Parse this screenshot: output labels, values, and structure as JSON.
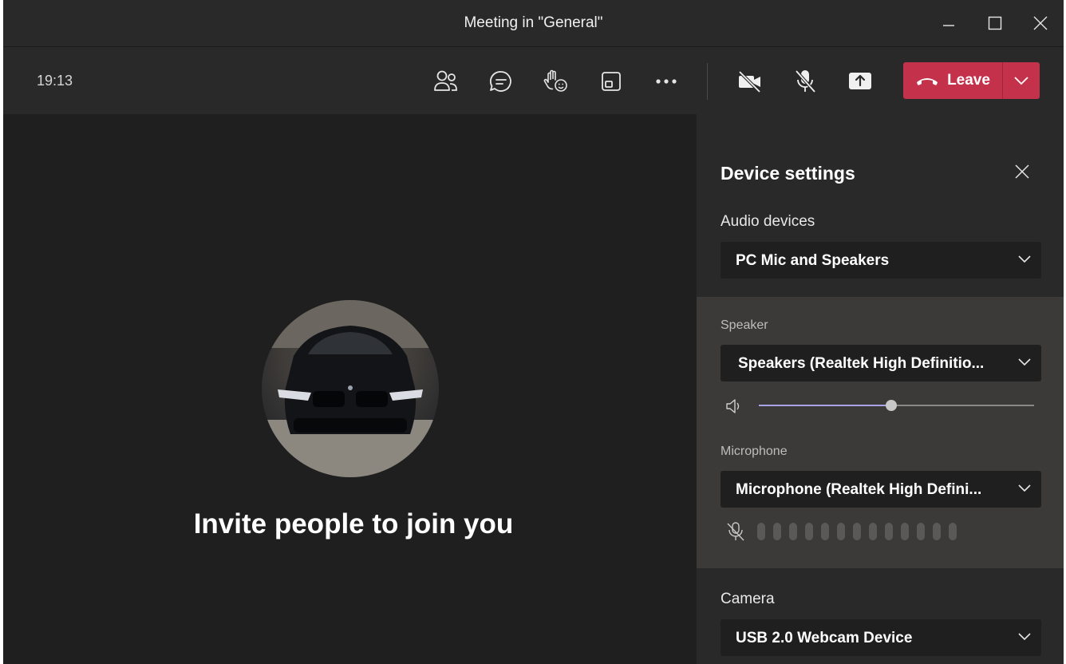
{
  "window": {
    "title": "Meeting in \"General\""
  },
  "toolbar": {
    "time": "19:13",
    "buttons": [
      {
        "name": "people",
        "icon": "people-icon"
      },
      {
        "name": "chat",
        "icon": "chat-icon"
      },
      {
        "name": "reactions",
        "icon": "raise-hand-icon"
      },
      {
        "name": "rooms",
        "icon": "room-icon"
      },
      {
        "name": "more",
        "icon": "more-icon"
      },
      {
        "name": "camera",
        "icon": "camera-off-icon"
      },
      {
        "name": "mic",
        "icon": "mic-off-icon"
      },
      {
        "name": "share",
        "icon": "share-icon"
      }
    ],
    "leave_label": "Leave",
    "leave_color": "#c4314b"
  },
  "stage": {
    "invite_text": "Invite people to join you"
  },
  "device_settings": {
    "title": "Device settings",
    "audio_devices_label": "Audio devices",
    "audio_device_value": "PC Mic and Speakers",
    "speaker_label": "Speaker",
    "speaker_value": "Speakers (Realtek High Definitio...",
    "speaker_volume": 0.48,
    "microphone_label": "Microphone",
    "microphone_value": "Microphone (Realtek High Defini...",
    "mic_level_bars": 13,
    "camera_label": "Camera",
    "camera_value": "USB 2.0 Webcam Device"
  },
  "colors": {
    "background": "#1f1f1f",
    "panel": "#292929",
    "accent": "#a9a3e8"
  }
}
